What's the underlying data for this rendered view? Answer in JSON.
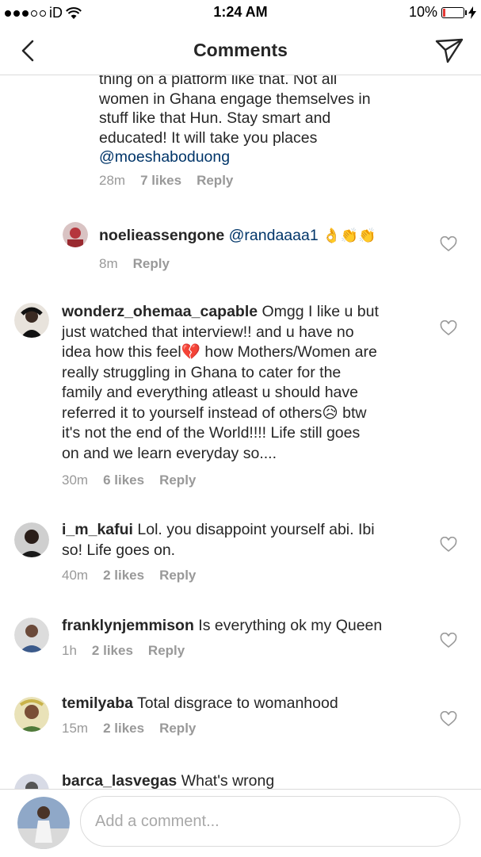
{
  "status_bar": {
    "carrier": "iD",
    "time": "1:24 AM",
    "battery": "10%"
  },
  "header": {
    "title": "Comments"
  },
  "top_partial": {
    "lines": [
      "thing on a platform like that. Not all",
      "women in Ghana engage themselves in",
      "stuff like that Hun. Stay smart and",
      "educated! It will take you places"
    ],
    "mention": "@moeshaboduong",
    "time": "28m",
    "likes": "7 likes",
    "reply": "Reply"
  },
  "comments": [
    {
      "username": "noelieassengone",
      "mention": "@randaaaa1",
      "emoji": "👌👏👏",
      "time": "8m",
      "reply": "Reply"
    },
    {
      "username": "wonderz_ohemaa_capable",
      "lines": [
        " Omgg I like u but",
        "just watched that interview!! and u have no",
        "idea how this feel💔 how Mothers/Women are",
        "really struggling in Ghana to cater for the",
        "family and everything atleast u should have",
        "referred it to yourself instead of others😥 btw",
        "it's not the end of the World!!!! Life still goes",
        "on and we learn everyday so...."
      ],
      "time": "30m",
      "likes": "6 likes",
      "reply": "Reply"
    },
    {
      "username": "i_m_kafui",
      "lines": [
        " Lol. you disappoint yourself abi. Ibi",
        "so! Life goes on."
      ],
      "time": "40m",
      "likes": "2 likes",
      "reply": "Reply"
    },
    {
      "username": "franklynjemmison",
      "lines": [
        " Is everything ok my Queen"
      ],
      "time": "1h",
      "likes": "2 likes",
      "reply": "Reply"
    },
    {
      "username": "temilyaba",
      "lines": [
        " Total disgrace to womanhood"
      ],
      "time": "15m",
      "likes": "2 likes",
      "reply": "Reply"
    },
    {
      "username": "barca_lasvegas",
      "lines": [
        " What's wrong"
      ]
    }
  ],
  "composer": {
    "placeholder": "Add a comment..."
  },
  "icons": {
    "back": "chevron-left-icon",
    "send": "paper-plane-icon",
    "like": "heart-outline-icon",
    "wifi": "wifi-icon",
    "battery": "battery-icon",
    "charging": "bolt-icon"
  },
  "colors": {
    "text": "#262626",
    "meta": "#999999",
    "mention": "#003569",
    "divider": "#dbdbdb",
    "battery_low": "#e53935"
  }
}
